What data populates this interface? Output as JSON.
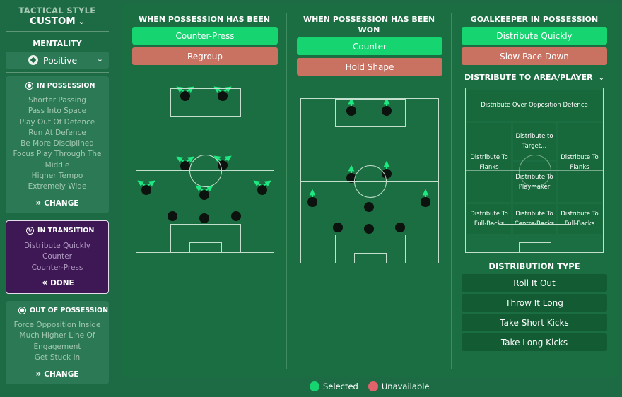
{
  "sidebar": {
    "style_label": "TACTICAL STYLE",
    "style_value": "CUSTOM",
    "mentality_label": "MENTALITY",
    "mentality_value": "Positive",
    "in_possession": {
      "title": "IN POSSESSION",
      "items": [
        "Shorter Passing",
        "Pass Into Space",
        "Play Out Of Defence",
        "Run At Defence",
        "Be More Disciplined",
        "Focus Play Through The",
        "Middle",
        "Higher Tempo",
        "Extremely Wide"
      ],
      "button": "CHANGE"
    },
    "in_transition": {
      "title": "IN TRANSITION",
      "items": [
        "Distribute Quickly",
        "Counter",
        "Counter-Press"
      ],
      "button": "DONE"
    },
    "out_of_possession": {
      "title": "OUT OF POSSESSION",
      "items": [
        "Force Opposition Inside",
        "Much Higher Line Of",
        "Engagement",
        "Get Stuck In"
      ],
      "button": "CHANGE"
    }
  },
  "lost": {
    "title": "WHEN POSSESSION HAS BEEN LOST",
    "options": [
      {
        "label": "Counter-Press",
        "state": "selected"
      },
      {
        "label": "Regroup",
        "state": "unavailable"
      }
    ]
  },
  "won": {
    "title_line1": "WHEN POSSESSION HAS BEEN",
    "title_line2": "WON",
    "options": [
      {
        "label": "Counter",
        "state": "selected"
      },
      {
        "label": "Hold Shape",
        "state": "unavailable"
      }
    ]
  },
  "goalkeeper": {
    "title": "GOALKEEPER IN POSSESSION",
    "options": [
      {
        "label": "Distribute Quickly",
        "state": "selected"
      },
      {
        "label": "Slow Pace Down",
        "state": "unavailable"
      }
    ],
    "distribute_heading": "DISTRIBUTE TO AREA/PLAYER",
    "zones": {
      "over_defence": "Distribute Over Opposition Defence",
      "target_1": "Distribute to",
      "target_2": "Target...",
      "flanks_left_1": "Distribute To",
      "flanks_left_2": "Flanks",
      "flanks_right_1": "Distribute To",
      "flanks_right_2": "Flanks",
      "playmaker_1": "Distribute To",
      "playmaker_2": "Playmaker",
      "fullbacks_left_1": "Distribute To",
      "fullbacks_left_2": "Full-Backs",
      "centrebacks_1": "Distribute To",
      "centrebacks_2": "Centre-Backs",
      "fullbacks_right_1": "Distribute To",
      "fullbacks_right_2": "Full-Backs"
    },
    "dist_type_title": "DISTRIBUTION TYPE",
    "dist_types": [
      "Roll It Out",
      "Throw It Long",
      "Take Short Kicks",
      "Take Long Kicks"
    ]
  },
  "legend": {
    "selected": "Selected",
    "unavailable": "Unavailable"
  },
  "colors": {
    "selected": "#16d571",
    "unavailable": "#c97262",
    "transition_card": "#3e1854"
  }
}
